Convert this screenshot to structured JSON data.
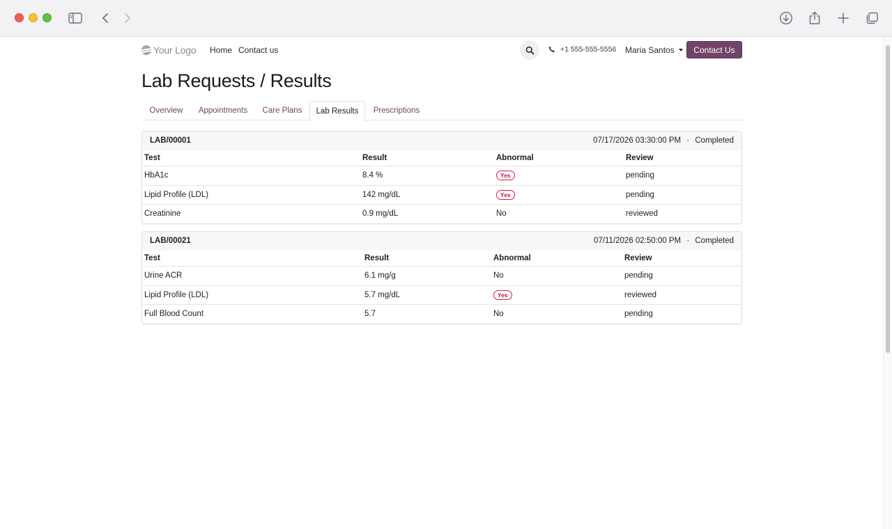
{
  "header": {
    "logo": "Your Logo",
    "nav": [
      "Home",
      "Contact us"
    ],
    "phone": "+1 555-555-5556",
    "user": "Maria Santos",
    "cta": "Contact Us"
  },
  "page": {
    "title": "Lab Requests / Results",
    "tabs": [
      "Overview",
      "Appointments",
      "Care Plans",
      "Lab Results",
      "Prescriptions"
    ],
    "active_tab": "Lab Results"
  },
  "columns": [
    "Test",
    "Result",
    "Abnormal",
    "Review"
  ],
  "labs": [
    {
      "id": "LAB/00001",
      "datetime": "07/17/2026 03:30:00 PM",
      "status": "Completed",
      "rows": [
        {
          "test": "HbA1c",
          "result": "8.4 %",
          "abnormal": "Yes",
          "review": "pending"
        },
        {
          "test": "Lipid Profile (LDL)",
          "result": "142 mg/dL",
          "abnormal": "Yes",
          "review": "pending"
        },
        {
          "test": "Creatinine",
          "result": "0.9 mg/dL",
          "abnormal": "No",
          "review": "reviewed"
        }
      ]
    },
    {
      "id": "LAB/00021",
      "datetime": "07/11/2026 02:50:00 PM",
      "status": "Completed",
      "rows": [
        {
          "test": "Urine ACR",
          "result": "6.1 mg/g",
          "abnormal": "No",
          "review": "pending"
        },
        {
          "test": "Lipid Profile (LDL)",
          "result": "5.7 mg/dL",
          "abnormal": "Yes",
          "review": "reviewed"
        },
        {
          "test": "Full Blood Count",
          "result": "5.7",
          "abnormal": "No",
          "review": "pending"
        }
      ]
    }
  ],
  "separator": "·",
  "colors": {
    "brand": "#714467",
    "badge": "#d21d45"
  }
}
